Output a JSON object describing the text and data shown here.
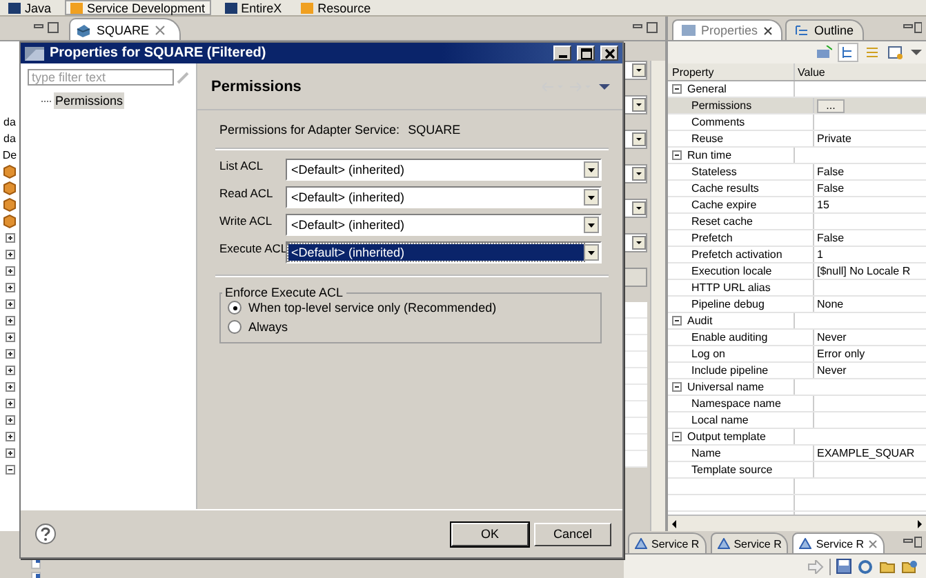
{
  "perspectives": [
    {
      "label": "Java",
      "selected": false
    },
    {
      "label": "Service Development",
      "selected": true
    },
    {
      "label": "EntireX",
      "selected": false
    },
    {
      "label": "Resource",
      "selected": false
    }
  ],
  "editor": {
    "tab": "SQUARE",
    "tree_labels": [
      "da",
      "da",
      "De"
    ]
  },
  "properties_view": {
    "tabs": [
      {
        "label": "Properties",
        "selected": true
      },
      {
        "label": "Outline",
        "selected": false
      }
    ],
    "columns": [
      "Property",
      "Value"
    ],
    "categories": [
      {
        "label": "General",
        "expanded": true,
        "children": [
          {
            "label": "Permissions",
            "kind": "button",
            "value": "...",
            "selected": true
          },
          {
            "label": "Comments",
            "kind": "text",
            "selected": false
          },
          {
            "label": "Reuse",
            "kind": "text",
            "value": "Private",
            "selected": false
          }
        ]
      },
      {
        "label": "Run time",
        "expanded": true,
        "children": [
          {
            "label": "Stateless",
            "kind": "text",
            "value": "False",
            "selected": false
          },
          {
            "label": "Cache results",
            "kind": "text",
            "value": "False",
            "selected": false
          },
          {
            "label": "Cache expire",
            "kind": "text",
            "value": "15",
            "selected": false
          },
          {
            "label": "Reset cache",
            "kind": "text",
            "selected": false
          },
          {
            "label": "Prefetch",
            "kind": "text",
            "value": "False",
            "selected": false
          },
          {
            "label": "Prefetch activation",
            "kind": "text",
            "value": "1",
            "selected": false
          },
          {
            "label": "Execution locale",
            "kind": "text",
            "value": "[$null] No Locale R",
            "selected": false
          },
          {
            "label": "HTTP URL alias",
            "kind": "text",
            "selected": false
          },
          {
            "label": "Pipeline debug",
            "kind": "text",
            "value": "None",
            "selected": false
          }
        ]
      },
      {
        "label": "Audit",
        "expanded": true,
        "children": [
          {
            "label": "Enable auditing",
            "kind": "text",
            "value": "Never",
            "selected": false
          },
          {
            "label": "Log on",
            "kind": "text",
            "value": "Error only",
            "selected": false
          },
          {
            "label": "Include pipeline",
            "kind": "text",
            "value": "Never",
            "selected": false
          }
        ]
      },
      {
        "label": "Universal name",
        "expanded": true,
        "children": [
          {
            "label": "Namespace name",
            "kind": "text",
            "selected": false
          },
          {
            "label": "Local name",
            "kind": "text",
            "selected": false
          }
        ]
      },
      {
        "label": "Output template",
        "expanded": true,
        "children": [
          {
            "label": "Name",
            "kind": "text",
            "value": "EXAMPLE_SQUAR",
            "selected": false
          },
          {
            "label": "Template source",
            "kind": "text",
            "selected": false
          }
        ]
      }
    ]
  },
  "service_tabs": [
    {
      "label": "Service R",
      "selected": false
    },
    {
      "label": "Service R",
      "selected": false
    },
    {
      "label": "Service R",
      "selected": true
    }
  ],
  "dialog": {
    "title": "Properties for SQUARE (Filtered)",
    "filter": {
      "placeholder": "type filter text"
    },
    "nav": [
      {
        "label": "Permissions",
        "selected": true
      }
    ],
    "page_title": "Permissions",
    "intro_label": "Permissions for Adapter Service:",
    "intro_value": "SQUARE",
    "acls": [
      {
        "label": "List ACL",
        "value": "<Default> (inherited)",
        "focused": false
      },
      {
        "label": "Read ACL",
        "value": "<Default> (inherited)",
        "focused": false
      },
      {
        "label": "Write ACL",
        "value": "<Default> (inherited)",
        "focused": false
      },
      {
        "label": "Execute ACL",
        "value": "<Default> (inherited)",
        "focused": true
      }
    ],
    "group": {
      "title": "Enforce Execute ACL",
      "options": [
        {
          "label": "When top-level service only (Recommended)",
          "selected": true
        },
        {
          "label": "Always",
          "selected": false
        }
      ]
    },
    "buttons": [
      "OK",
      "Cancel"
    ]
  }
}
